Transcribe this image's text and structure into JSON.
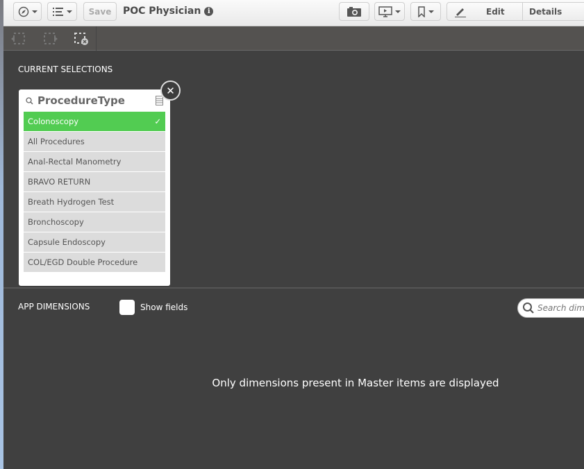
{
  "toolbar": {
    "save_label": "Save",
    "app_title": "POC Physician",
    "edit_label": "Edit",
    "details_label": "Details"
  },
  "selections": {
    "heading": "CURRENT SELECTIONS",
    "listbox": {
      "field": "ProcedureType",
      "items": [
        {
          "label": "Colonoscopy",
          "selected": true
        },
        {
          "label": "All Procedures"
        },
        {
          "label": "Anal-Rectal Manometry"
        },
        {
          "label": "BRAVO RETURN"
        },
        {
          "label": "Breath Hydrogen Test"
        },
        {
          "label": "Bronchoscopy"
        },
        {
          "label": "Capsule Endoscopy"
        },
        {
          "label": "COL/EGD Double Procedure"
        }
      ]
    }
  },
  "dimensions": {
    "heading": "APP DIMENSIONS",
    "show_fields_label": "Show fields",
    "search_placeholder": "Search dimensions",
    "empty_message": "Only dimensions present in Master items are displayed"
  },
  "colors": {
    "selected": "#52cc52",
    "background": "#404040"
  }
}
